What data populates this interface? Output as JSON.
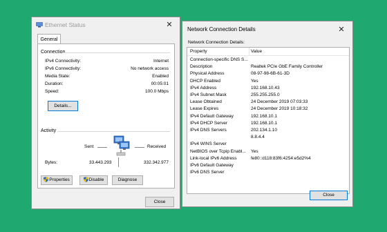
{
  "ethernet_status": {
    "title": "Ethernet Status",
    "tab": "General",
    "connection_label": "Connection",
    "rows": [
      {
        "label": "IPv4 Connectivity:",
        "value": "Internet"
      },
      {
        "label": "IPv6 Connectivity:",
        "value": "No network access"
      },
      {
        "label": "Media State:",
        "value": "Enabled"
      },
      {
        "label": "Duration:",
        "value": "00:05:01"
      },
      {
        "label": "Speed:",
        "value": "100.0 Mbps"
      }
    ],
    "details_button": "Details...",
    "activity_label": "Activity",
    "sent_label": "Sent",
    "received_label": "Received",
    "bytes_label": "Bytes:",
    "bytes_sent": "33.443.293",
    "bytes_received": "332.342.977",
    "properties_button": "Properties",
    "disable_button": "Disable",
    "diagnose_button": "Diagnose",
    "close_button": "Close"
  },
  "details": {
    "title": "Network Connection Details",
    "heading": "Network Connection Details:",
    "col_property": "Property",
    "col_value": "Value",
    "rows": [
      {
        "property": "Connection-specific DNS S...",
        "value": ""
      },
      {
        "property": "Description",
        "value": "Realtek PCIe GbE Family Controller"
      },
      {
        "property": "Physical Address",
        "value": "08-97-98-6B-61-3D"
      },
      {
        "property": "DHCP Enabled",
        "value": "Yes"
      },
      {
        "property": "IPv4 Address",
        "value": "192.168.10.43"
      },
      {
        "property": "IPv4 Subnet Mask",
        "value": "255.255.255.0"
      },
      {
        "property": "Lease Obtained",
        "value": "24 December 2019 07:03:33"
      },
      {
        "property": "Lease Expires",
        "value": "24 December 2019 10:18:32"
      },
      {
        "property": "IPv4 Default Gateway",
        "value": "192.168.10.1"
      },
      {
        "property": "IPv4 DHCP Server",
        "value": "192.168.10.1"
      },
      {
        "property": "IPv4 DNS Servers",
        "value": "202.134.1.10"
      },
      {
        "property": "",
        "value": "8.8.4.4"
      },
      {
        "property": "IPv4 WINS Server",
        "value": ""
      },
      {
        "property": "NetBIOS over Tcpip Enabl...",
        "value": "Yes"
      },
      {
        "property": "Link-local IPv6 Address",
        "value": "fe80::d118:83f6:4254:e5d2%4"
      },
      {
        "property": "IPv6 Default Gateway",
        "value": ""
      },
      {
        "property": "IPv6 DNS Server",
        "value": ""
      }
    ],
    "close_button": "Close"
  },
  "close_glyph": "✕",
  "colors": {
    "background": "#1fa970",
    "accent": "#0078d7"
  }
}
